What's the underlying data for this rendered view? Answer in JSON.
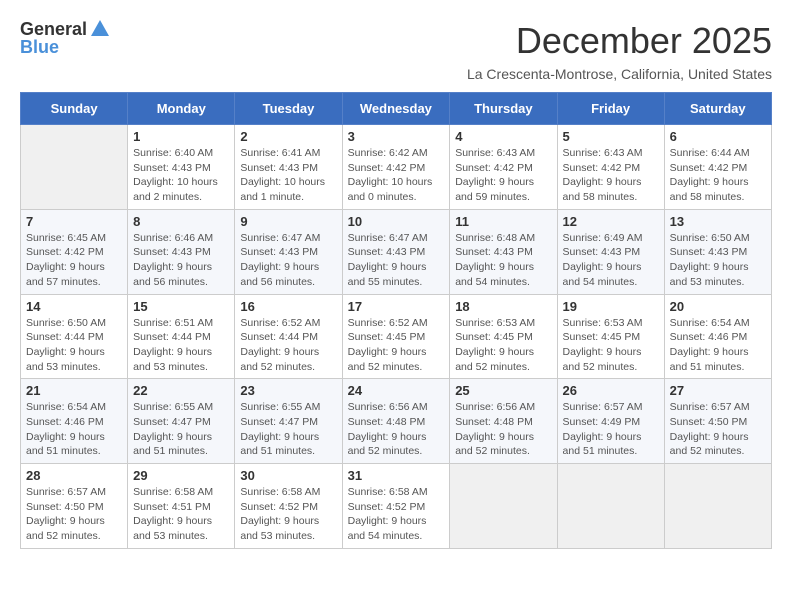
{
  "logo": {
    "general": "General",
    "blue": "Blue"
  },
  "title": "December 2025",
  "subtitle": "La Crescenta-Montrose, California, United States",
  "headers": [
    "Sunday",
    "Monday",
    "Tuesday",
    "Wednesday",
    "Thursday",
    "Friday",
    "Saturday"
  ],
  "weeks": [
    [
      {
        "day": "",
        "sunrise": "",
        "sunset": "",
        "daylight": ""
      },
      {
        "day": "1",
        "sunrise": "Sunrise: 6:40 AM",
        "sunset": "Sunset: 4:43 PM",
        "daylight": "Daylight: 10 hours and 2 minutes."
      },
      {
        "day": "2",
        "sunrise": "Sunrise: 6:41 AM",
        "sunset": "Sunset: 4:43 PM",
        "daylight": "Daylight: 10 hours and 1 minute."
      },
      {
        "day": "3",
        "sunrise": "Sunrise: 6:42 AM",
        "sunset": "Sunset: 4:42 PM",
        "daylight": "Daylight: 10 hours and 0 minutes."
      },
      {
        "day": "4",
        "sunrise": "Sunrise: 6:43 AM",
        "sunset": "Sunset: 4:42 PM",
        "daylight": "Daylight: 9 hours and 59 minutes."
      },
      {
        "day": "5",
        "sunrise": "Sunrise: 6:43 AM",
        "sunset": "Sunset: 4:42 PM",
        "daylight": "Daylight: 9 hours and 58 minutes."
      },
      {
        "day": "6",
        "sunrise": "Sunrise: 6:44 AM",
        "sunset": "Sunset: 4:42 PM",
        "daylight": "Daylight: 9 hours and 58 minutes."
      }
    ],
    [
      {
        "day": "7",
        "sunrise": "Sunrise: 6:45 AM",
        "sunset": "Sunset: 4:42 PM",
        "daylight": "Daylight: 9 hours and 57 minutes."
      },
      {
        "day": "8",
        "sunrise": "Sunrise: 6:46 AM",
        "sunset": "Sunset: 4:43 PM",
        "daylight": "Daylight: 9 hours and 56 minutes."
      },
      {
        "day": "9",
        "sunrise": "Sunrise: 6:47 AM",
        "sunset": "Sunset: 4:43 PM",
        "daylight": "Daylight: 9 hours and 56 minutes."
      },
      {
        "day": "10",
        "sunrise": "Sunrise: 6:47 AM",
        "sunset": "Sunset: 4:43 PM",
        "daylight": "Daylight: 9 hours and 55 minutes."
      },
      {
        "day": "11",
        "sunrise": "Sunrise: 6:48 AM",
        "sunset": "Sunset: 4:43 PM",
        "daylight": "Daylight: 9 hours and 54 minutes."
      },
      {
        "day": "12",
        "sunrise": "Sunrise: 6:49 AM",
        "sunset": "Sunset: 4:43 PM",
        "daylight": "Daylight: 9 hours and 54 minutes."
      },
      {
        "day": "13",
        "sunrise": "Sunrise: 6:50 AM",
        "sunset": "Sunset: 4:43 PM",
        "daylight": "Daylight: 9 hours and 53 minutes."
      }
    ],
    [
      {
        "day": "14",
        "sunrise": "Sunrise: 6:50 AM",
        "sunset": "Sunset: 4:44 PM",
        "daylight": "Daylight: 9 hours and 53 minutes."
      },
      {
        "day": "15",
        "sunrise": "Sunrise: 6:51 AM",
        "sunset": "Sunset: 4:44 PM",
        "daylight": "Daylight: 9 hours and 53 minutes."
      },
      {
        "day": "16",
        "sunrise": "Sunrise: 6:52 AM",
        "sunset": "Sunset: 4:44 PM",
        "daylight": "Daylight: 9 hours and 52 minutes."
      },
      {
        "day": "17",
        "sunrise": "Sunrise: 6:52 AM",
        "sunset": "Sunset: 4:45 PM",
        "daylight": "Daylight: 9 hours and 52 minutes."
      },
      {
        "day": "18",
        "sunrise": "Sunrise: 6:53 AM",
        "sunset": "Sunset: 4:45 PM",
        "daylight": "Daylight: 9 hours and 52 minutes."
      },
      {
        "day": "19",
        "sunrise": "Sunrise: 6:53 AM",
        "sunset": "Sunset: 4:45 PM",
        "daylight": "Daylight: 9 hours and 52 minutes."
      },
      {
        "day": "20",
        "sunrise": "Sunrise: 6:54 AM",
        "sunset": "Sunset: 4:46 PM",
        "daylight": "Daylight: 9 hours and 51 minutes."
      }
    ],
    [
      {
        "day": "21",
        "sunrise": "Sunrise: 6:54 AM",
        "sunset": "Sunset: 4:46 PM",
        "daylight": "Daylight: 9 hours and 51 minutes."
      },
      {
        "day": "22",
        "sunrise": "Sunrise: 6:55 AM",
        "sunset": "Sunset: 4:47 PM",
        "daylight": "Daylight: 9 hours and 51 minutes."
      },
      {
        "day": "23",
        "sunrise": "Sunrise: 6:55 AM",
        "sunset": "Sunset: 4:47 PM",
        "daylight": "Daylight: 9 hours and 51 minutes."
      },
      {
        "day": "24",
        "sunrise": "Sunrise: 6:56 AM",
        "sunset": "Sunset: 4:48 PM",
        "daylight": "Daylight: 9 hours and 52 minutes."
      },
      {
        "day": "25",
        "sunrise": "Sunrise: 6:56 AM",
        "sunset": "Sunset: 4:48 PM",
        "daylight": "Daylight: 9 hours and 52 minutes."
      },
      {
        "day": "26",
        "sunrise": "Sunrise: 6:57 AM",
        "sunset": "Sunset: 4:49 PM",
        "daylight": "Daylight: 9 hours and 51 minutes."
      },
      {
        "day": "27",
        "sunrise": "Sunrise: 6:57 AM",
        "sunset": "Sunset: 4:50 PM",
        "daylight": "Daylight: 9 hours and 52 minutes."
      }
    ],
    [
      {
        "day": "28",
        "sunrise": "Sunrise: 6:57 AM",
        "sunset": "Sunset: 4:50 PM",
        "daylight": "Daylight: 9 hours and 52 minutes."
      },
      {
        "day": "29",
        "sunrise": "Sunrise: 6:58 AM",
        "sunset": "Sunset: 4:51 PM",
        "daylight": "Daylight: 9 hours and 53 minutes."
      },
      {
        "day": "30",
        "sunrise": "Sunrise: 6:58 AM",
        "sunset": "Sunset: 4:52 PM",
        "daylight": "Daylight: 9 hours and 53 minutes."
      },
      {
        "day": "31",
        "sunrise": "Sunrise: 6:58 AM",
        "sunset": "Sunset: 4:52 PM",
        "daylight": "Daylight: 9 hours and 54 minutes."
      },
      {
        "day": "",
        "sunrise": "",
        "sunset": "",
        "daylight": ""
      },
      {
        "day": "",
        "sunrise": "",
        "sunset": "",
        "daylight": ""
      },
      {
        "day": "",
        "sunrise": "",
        "sunset": "",
        "daylight": ""
      }
    ]
  ]
}
